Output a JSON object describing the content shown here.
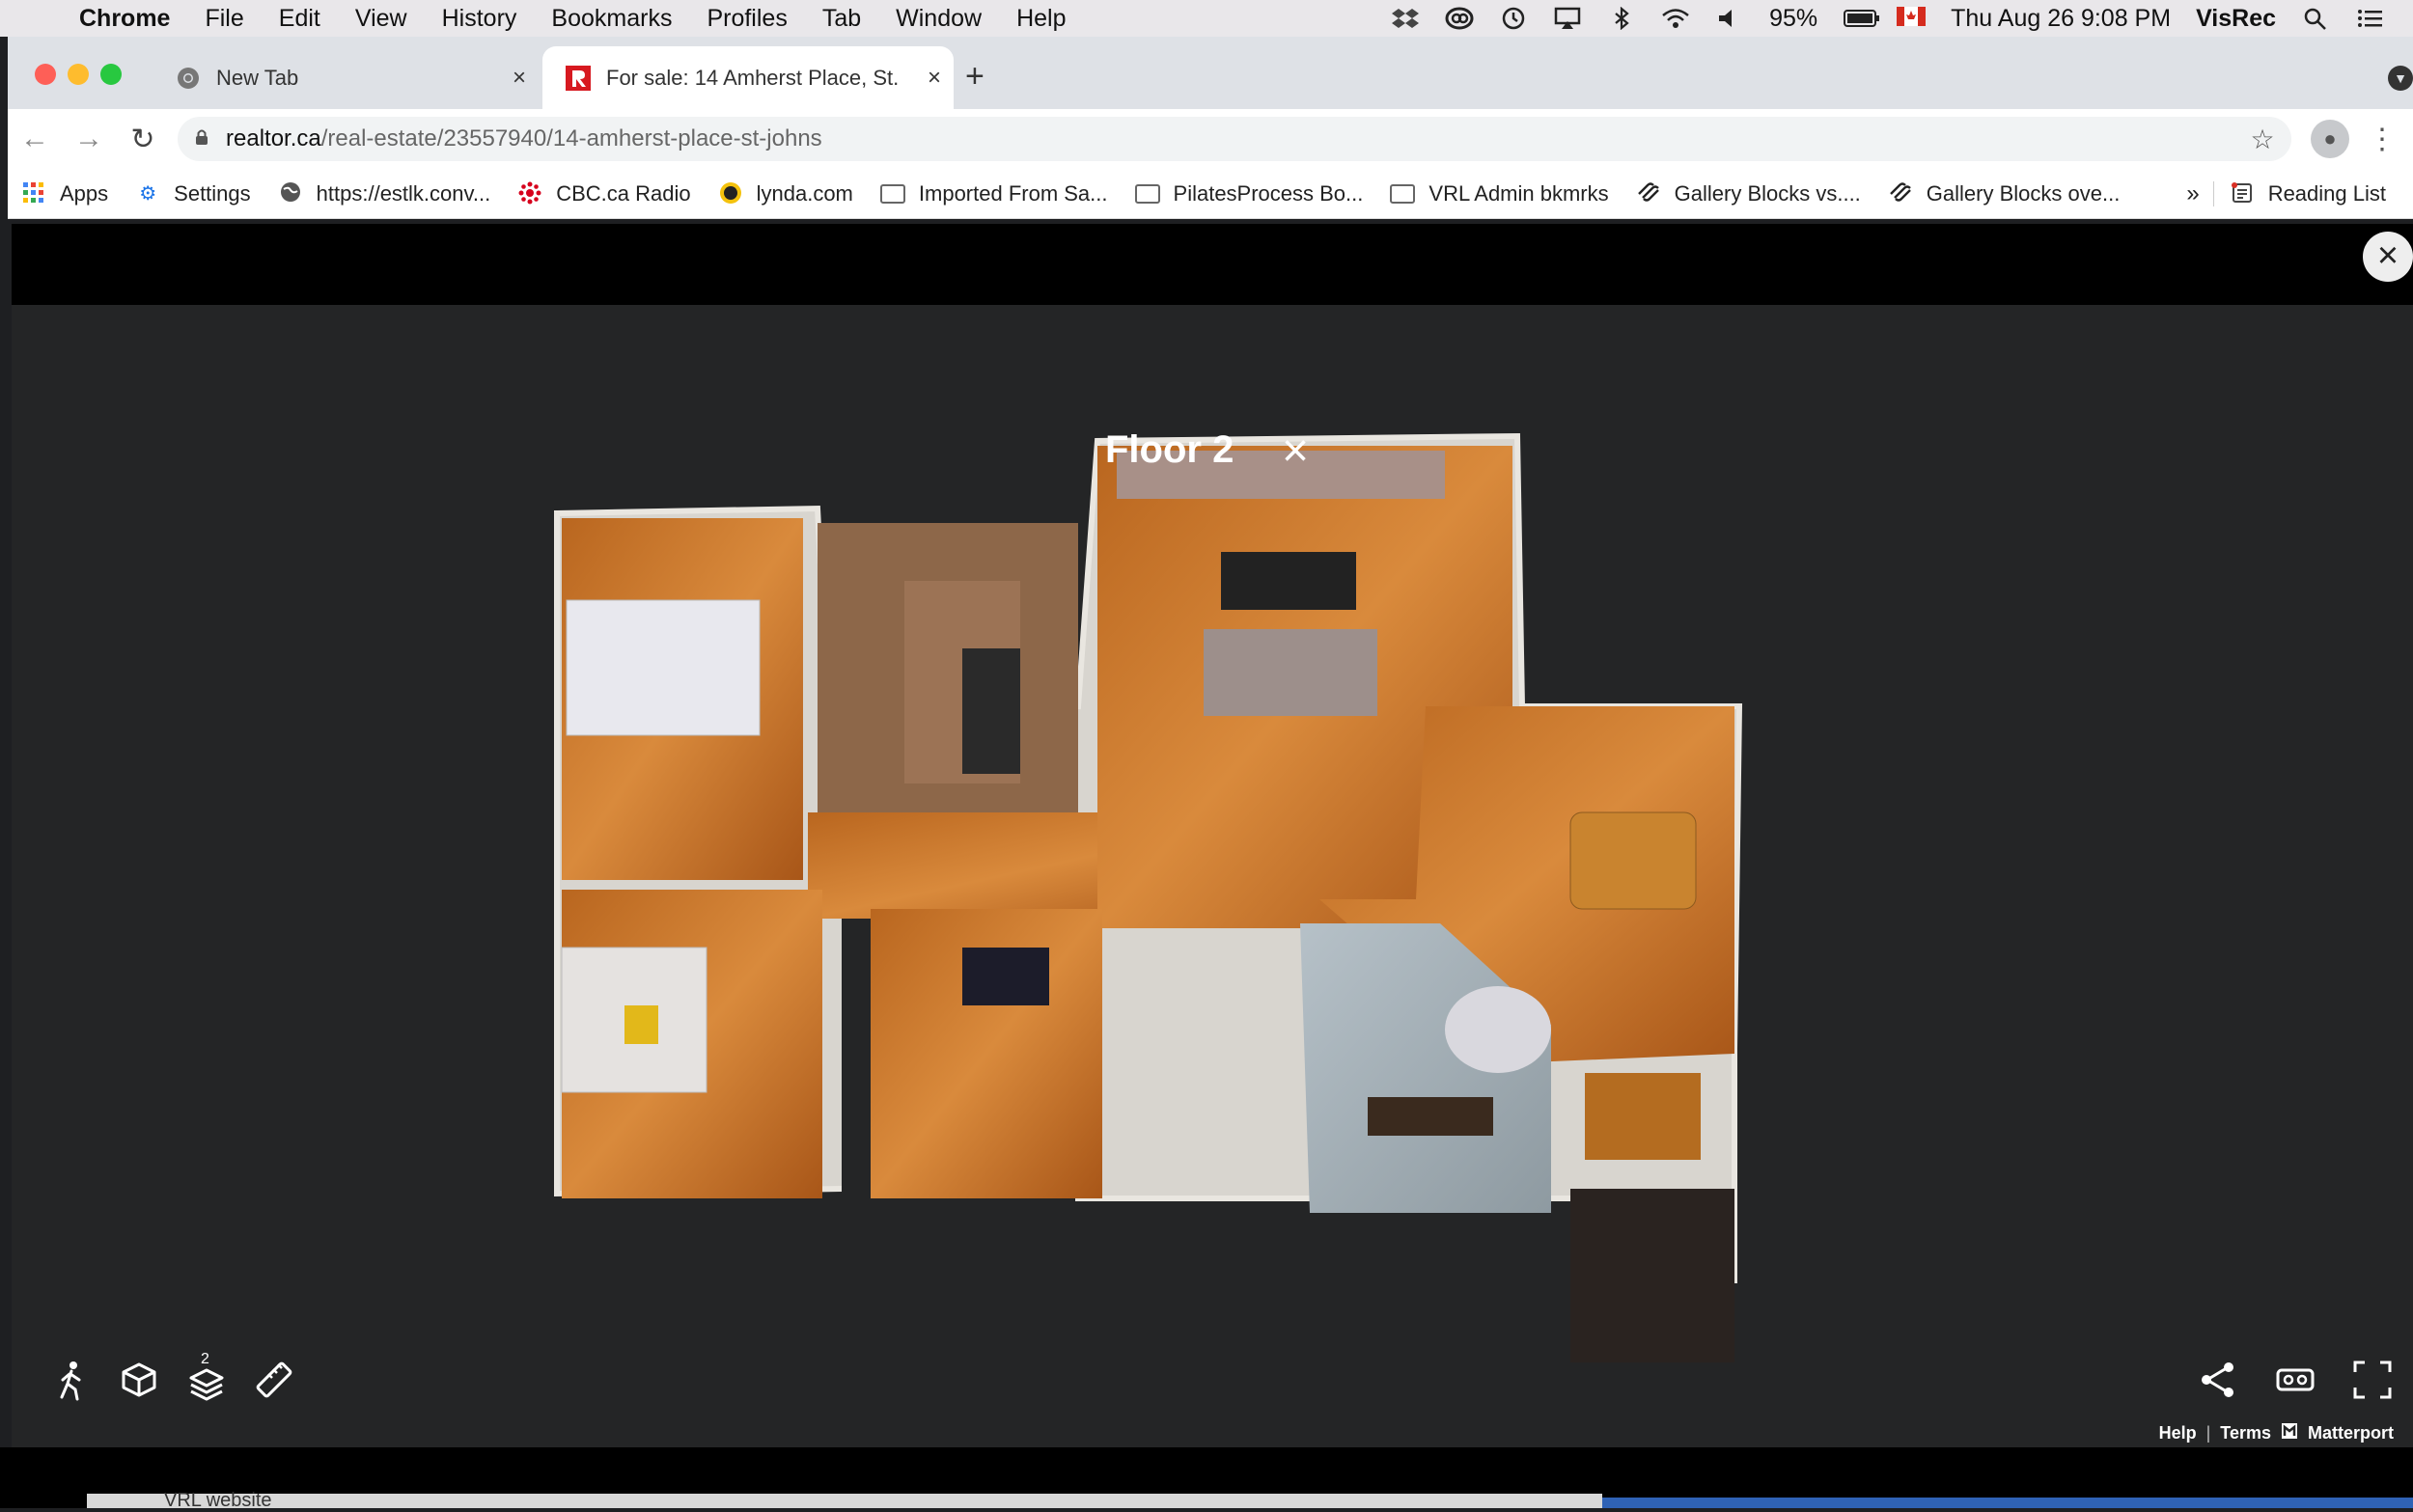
{
  "menubar": {
    "app": "Chrome",
    "items": [
      "File",
      "Edit",
      "View",
      "History",
      "Bookmarks",
      "Profiles",
      "Tab",
      "Window",
      "Help"
    ],
    "battery": "95%",
    "datetime": "Thu Aug 26  9:08 PM",
    "user": "VisRec"
  },
  "tabs": [
    {
      "title": "New Tab",
      "close": "×"
    },
    {
      "title": "For sale: 14 Amherst Place, St.",
      "close": "×"
    }
  ],
  "new_tab_label": "+",
  "toolbar": {
    "url_host": "realtor.ca",
    "url_path": "/real-estate/23557940/14-amherst-place-st-johns"
  },
  "bookmarks": [
    {
      "label": "Apps",
      "icon": "apps-grid-icon"
    },
    {
      "label": "Settings",
      "icon": "gear-icon"
    },
    {
      "label": "https://estlk.conv...",
      "icon": "globe-icon"
    },
    {
      "label": "CBC.ca Radio",
      "icon": "cbc-icon"
    },
    {
      "label": "lynda.com",
      "icon": "lynda-icon"
    },
    {
      "label": "Imported From Sa...",
      "icon": "folder-icon"
    },
    {
      "label": "PilatesProcess Bo...",
      "icon": "folder-icon"
    },
    {
      "label": "VRL Admin bkmrks",
      "icon": "folder-icon"
    },
    {
      "label": "Gallery Blocks vs....",
      "icon": "squarespace-icon"
    },
    {
      "label": "Gallery Blocks ove...",
      "icon": "squarespace-icon"
    }
  ],
  "bookmarks_more": "»",
  "reading_list": "Reading List",
  "viewer": {
    "floor_title": "Floor 2",
    "floor_badge": "2",
    "footer": {
      "help": "Help",
      "sep": "|",
      "terms": "Terms",
      "brand": "Matterport"
    }
  },
  "desktop_peek_text": "VRL website"
}
